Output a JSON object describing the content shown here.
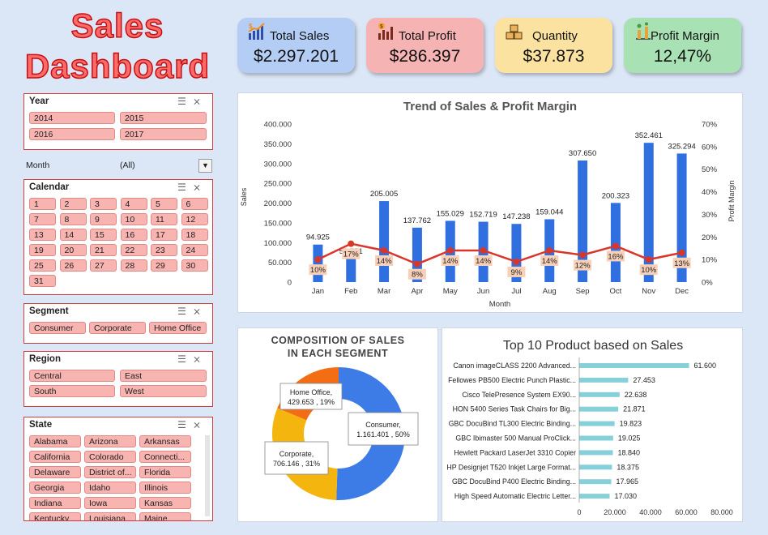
{
  "title": {
    "line1": "Sales",
    "line2": "Dashboard"
  },
  "kpis": [
    {
      "label": "Total Sales",
      "value": "$2.297.201",
      "color": "#b4cdf5",
      "icon": "sales-chart-icon"
    },
    {
      "label": "Total Profit",
      "value": "$286.397",
      "color": "#f5b3b3",
      "icon": "profit-chart-icon"
    },
    {
      "label": "Quantity",
      "value": "$37.873",
      "color": "#fbe2a0",
      "icon": "boxes-icon"
    },
    {
      "label": "Profit Margin",
      "value": "12,47%",
      "color": "#a8e2b4",
      "icon": "margin-icon"
    }
  ],
  "slicers": {
    "year": {
      "label": "Year",
      "items": [
        "2014",
        "2015",
        "2016",
        "2017"
      ]
    },
    "month": {
      "label": "Month",
      "value": "(All)"
    },
    "calendar": {
      "label": "Calendar",
      "items": [
        "1",
        "2",
        "3",
        "4",
        "5",
        "6",
        "7",
        "8",
        "9",
        "10",
        "11",
        "12",
        "13",
        "14",
        "15",
        "16",
        "17",
        "18",
        "19",
        "20",
        "21",
        "22",
        "23",
        "24",
        "25",
        "26",
        "27",
        "28",
        "29",
        "30",
        "31"
      ]
    },
    "segment": {
      "label": "Segment",
      "items": [
        "Consumer",
        "Corporate",
        "Home Office"
      ]
    },
    "region": {
      "label": "Region",
      "items": [
        "Central",
        "East",
        "South",
        "West"
      ]
    },
    "state": {
      "label": "State",
      "items": [
        "Alabama",
        "Arizona",
        "Arkansas",
        "California",
        "Colorado",
        "Connecti...",
        "Delaware",
        "District of...",
        "Florida",
        "Georgia",
        "Idaho",
        "Illinois",
        "Indiana",
        "Iowa",
        "Kansas",
        "Kentucky",
        "Louisiana",
        "Maine"
      ]
    }
  },
  "chart_data": [
    {
      "type": "bar",
      "title": "Trend of Sales & Profit Margin",
      "xlabel": "Month",
      "ylabel": "Sales",
      "y2label": "Profit Margin",
      "ylim": [
        0,
        400000
      ],
      "y2lim": [
        0,
        70
      ],
      "yticks": [
        "0",
        "50.000",
        "100.000",
        "150.000",
        "200.000",
        "250.000",
        "300.000",
        "350.000",
        "400.000"
      ],
      "y2ticks": [
        "0%",
        "10%",
        "20%",
        "30%",
        "40%",
        "50%",
        "60%",
        "70%"
      ],
      "categories": [
        "Jan",
        "Feb",
        "Mar",
        "Apr",
        "May",
        "Jun",
        "Jul",
        "Aug",
        "Sep",
        "Oct",
        "Nov",
        "Dec"
      ],
      "series": [
        {
          "name": "Sales",
          "type": "bar",
          "color": "#2f6fe0",
          "values": [
            94925,
            59751,
            205005,
            137762,
            155029,
            152719,
            147238,
            159044,
            307650,
            200323,
            352461,
            325294
          ],
          "labels": [
            "94.925",
            "59.751",
            "205.005",
            "137.762",
            "155.029",
            "152.719",
            "147.238",
            "159.044",
            "307.650",
            "200.323",
            "352.461",
            "325.294"
          ]
        },
        {
          "name": "Profit Margin",
          "type": "line",
          "color": "#d9362b",
          "values": [
            10,
            17,
            14,
            8,
            14,
            14,
            9,
            14,
            12,
            16,
            10,
            13
          ],
          "labels": [
            "10%",
            "17%",
            "14%",
            "8%",
            "14%",
            "14%",
            "9%",
            "14%",
            "12%",
            "16%",
            "10%",
            "13%"
          ]
        }
      ]
    },
    {
      "type": "pie",
      "title": "COMPOSITION OF SALES IN EACH SEGMENT",
      "title_lines": [
        "COMPOSITION OF SALES",
        "IN EACH SEGMENT"
      ],
      "slices": [
        {
          "name": "Consumer",
          "value": 1161401,
          "percent": 50,
          "color": "#3d7be6",
          "label_l1": "Consumer,",
          "label_l2": "1.161.401 , 50%"
        },
        {
          "name": "Corporate",
          "value": 706146,
          "percent": 31,
          "color": "#f5b50f",
          "label_l1": "Corporate,",
          "label_l2": "706.146 , 31%"
        },
        {
          "name": "Home Office",
          "value": 429653,
          "percent": 19,
          "color": "#f36d14",
          "label_l1": "Home Office,",
          "label_l2": "429.653 , 19%"
        }
      ]
    },
    {
      "type": "bar",
      "orientation": "horizontal",
      "title": "Top 10 Product based on Sales",
      "xlim": [
        0,
        80000
      ],
      "xticks": [
        "0",
        "20.000",
        "40.000",
        "60.000",
        "80.000"
      ],
      "categories": [
        "Canon imageCLASS 2200 Advanced...",
        "Fellowes PB500 Electric Punch Plastic...",
        "Cisco TelePresence System EX90...",
        "HON 5400 Series Task Chairs for Big...",
        "GBC DocuBind TL300 Electric Binding...",
        "GBC Ibimaster 500 Manual ProClick...",
        "Hewlett Packard LaserJet 3310 Copier",
        "HP Designjet T520 Inkjet Large Format...",
        "GBC DocuBind P400 Electric Binding...",
        "High Speed Automatic Electric Letter..."
      ],
      "values": [
        61600,
        27453,
        22638,
        21871,
        19823,
        19025,
        18840,
        18375,
        17965,
        17030
      ],
      "labels": [
        "61.600",
        "27.453",
        "22.638",
        "21.871",
        "19.823",
        "19.025",
        "18.840",
        "18.375",
        "17.965",
        "17.030"
      ],
      "color": "#86d0da"
    }
  ]
}
